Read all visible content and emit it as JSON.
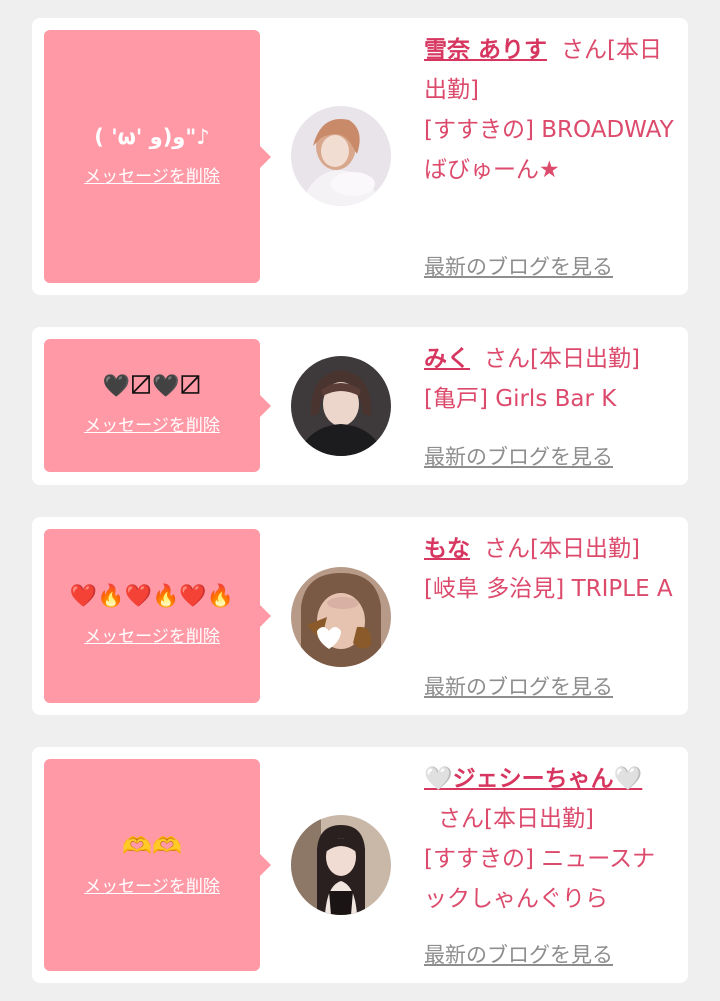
{
  "cards": [
    {
      "message": "( 'ω' و)و\"♪",
      "delete_label": "メッセージを削除",
      "name": "雪奈 ありす",
      "san": "さん[本日出勤]",
      "shop": "[すすきの] BROADWAYばびゅーん★",
      "blog": "最新のブログを見る"
    },
    {
      "message": "🖤〼🖤〼",
      "delete_label": "メッセージを削除",
      "name": "みく",
      "san": "さん[本日出勤]",
      "shop": "[亀戸] Girls Bar K",
      "blog": "最新のブログを見る"
    },
    {
      "message": "❤️🔥❤️🔥❤️🔥",
      "delete_label": "メッセージを削除",
      "name": "もな",
      "san": "さん[本日出勤]",
      "shop": "[岐阜 多治見] TRIPLE A",
      "blog": "最新のブログを見る"
    },
    {
      "message": "🫶🫶",
      "delete_label": "メッセージを削除",
      "name": "🤍ジェシーちゃん🤍",
      "san": "さん[本日出勤]",
      "shop": "[すすきの] ニュースナックしゃんぐりら",
      "blog": "最新のブログを見る"
    }
  ],
  "colors": {
    "background": "#efefef",
    "bubble": "#ff99a6",
    "name": "#d6365f",
    "info_text": "#dc4a6c",
    "blog_link": "#8e8e8e"
  }
}
